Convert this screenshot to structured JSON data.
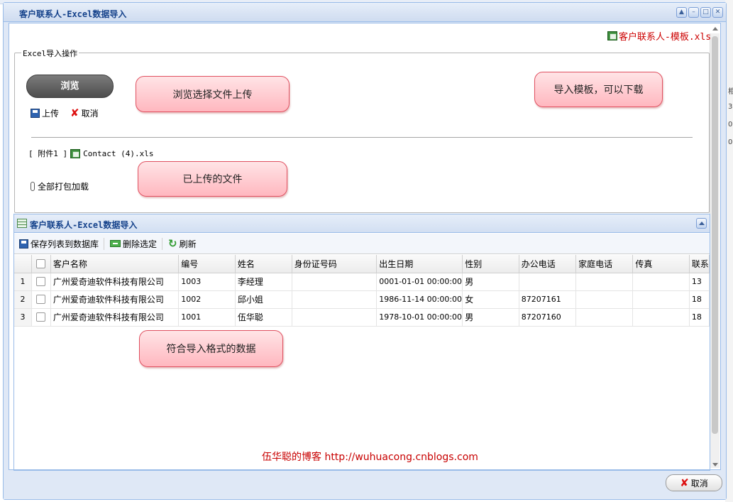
{
  "window": {
    "title": "客户联系人-Excel数据导入",
    "controls": [
      "minimize",
      "restore",
      "maximize",
      "close"
    ]
  },
  "template_link": "客户联系人-模板.xls",
  "import_section": {
    "legend": "Excel导入操作",
    "browse_label": "浏览",
    "upload_label": "上传",
    "cancel_label": "取消",
    "attachment_label": "[ 附件1 ]",
    "attachment_file": "Contact (4).xls",
    "pack_download_label": "全部打包加载"
  },
  "callouts": {
    "browse": "浏览选择文件上传",
    "template": "导入模板，可以下载",
    "uploaded": "已上传的文件",
    "matching": "符合导入格式的数据"
  },
  "grid": {
    "title": "客户联系人-Excel数据导入",
    "toolbar": {
      "save_label": "保存列表到数据库",
      "delete_label": "删除选定",
      "refresh_label": "刷新"
    },
    "columns": [
      "",
      "",
      "客户名称",
      "编号",
      "姓名",
      "身份证号码",
      "出生日期",
      "性别",
      "办公电话",
      "家庭电话",
      "传真",
      "联系"
    ],
    "rows": [
      [
        "1",
        "",
        "广州爱奇迪软件科技有限公司",
        "1003",
        "李经理",
        "",
        "0001-01-01 00:00:00",
        "男",
        "",
        "",
        "",
        "13"
      ],
      [
        "2",
        "",
        "广州爱奇迪软件科技有限公司",
        "1002",
        "邱小姐",
        "",
        "1986-11-14 00:00:00",
        "女",
        "87207161",
        "",
        "",
        "18"
      ],
      [
        "3",
        "",
        "广州爱奇迪软件科技有限公司",
        "1001",
        "伍华聪",
        "",
        "1978-10-01 00:00:00",
        "男",
        "87207160",
        "",
        "",
        "18"
      ]
    ]
  },
  "blog_text": "伍华聪的博客 http://wuhuacong.cnblogs.com",
  "footer": {
    "cancel_label": "取消"
  },
  "side_labels": [
    "相",
    "3",
    "0",
    "0"
  ],
  "colors": {
    "title_text": "#15428b",
    "frame_border": "#99bbe8",
    "link_red": "#cc0000",
    "callout_fill": "#ffb7bf",
    "callout_border": "#e05060"
  }
}
